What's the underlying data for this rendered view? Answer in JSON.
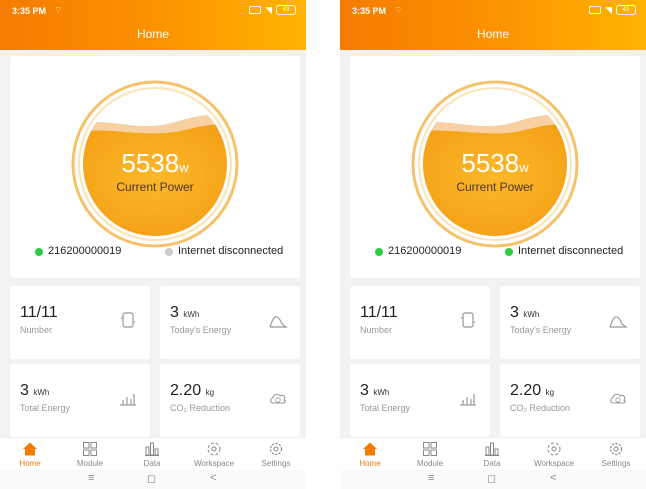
{
  "screens": [
    {
      "status": {
        "time": "3:35 PM",
        "battery": "43"
      },
      "header": {
        "title": "Home"
      },
      "gauge": {
        "value": "5538",
        "unit": "w",
        "label": "Current Power"
      },
      "device": {
        "id": "216200000019",
        "dot_color": "#2ecc40"
      },
      "internet": {
        "label": "Internet disconnected",
        "dot_color": "#cccccc"
      },
      "stats": {
        "number": {
          "value": "11/11",
          "label": "Number"
        },
        "today_energy": {
          "value": "3",
          "unit": "kWh",
          "label": "Today's Energy"
        },
        "total_energy": {
          "value": "3",
          "unit": "kWh",
          "label": "Total Energy"
        },
        "co2": {
          "value": "2.20",
          "unit": "kg",
          "label": "CO₂ Reduction"
        }
      },
      "tabs": [
        "Home",
        "Module",
        "Data",
        "Workspace",
        "Settings"
      ],
      "active_tab": "Home"
    },
    {
      "status": {
        "time": "3:35 PM",
        "battery": "43"
      },
      "header": {
        "title": "Home"
      },
      "gauge": {
        "value": "5538",
        "unit": "w",
        "label": "Current Power"
      },
      "device": {
        "id": "216200000019",
        "dot_color": "#2ecc40"
      },
      "internet": {
        "label": "Internet disconnected",
        "dot_color": "#2ecc40"
      },
      "stats": {
        "number": {
          "value": "11/11",
          "label": "Number"
        },
        "today_energy": {
          "value": "3",
          "unit": "kWh",
          "label": "Today's Energy"
        },
        "total_energy": {
          "value": "3",
          "unit": "kWh",
          "label": "Total Energy"
        },
        "co2": {
          "value": "2.20",
          "unit": "kg",
          "label": "CO₂ Reduction"
        }
      },
      "tabs": [
        "Home",
        "Module",
        "Data",
        "Workspace",
        "Settings"
      ],
      "active_tab": "Home"
    }
  ],
  "icons": {
    "status_signal": "wifi-signal-icon",
    "sim": "sim-card-icon",
    "wifi": "wifi-icon",
    "battery": "battery-icon",
    "number": "inverter-module-icon",
    "today_energy": "energy-curve-icon",
    "total_energy": "bar-chart-icon",
    "co2": "co2-cloud-icon",
    "tab_home": "home-icon",
    "tab_module": "grid-icon",
    "tab_data": "data-chart-icon",
    "tab_workspace": "workspace-icon",
    "tab_settings": "gear-icon",
    "nav_menu": "menu-icon",
    "nav_home": "circle-home-icon",
    "nav_back": "back-icon"
  },
  "colors": {
    "accent": "#f57c00",
    "header_gradient_end": "#ffb300",
    "gauge_fill": "#f9a825",
    "gauge_ring": "#f5c26b"
  },
  "navbar": {
    "menu": "≡",
    "home": "◻",
    "back": "<"
  }
}
